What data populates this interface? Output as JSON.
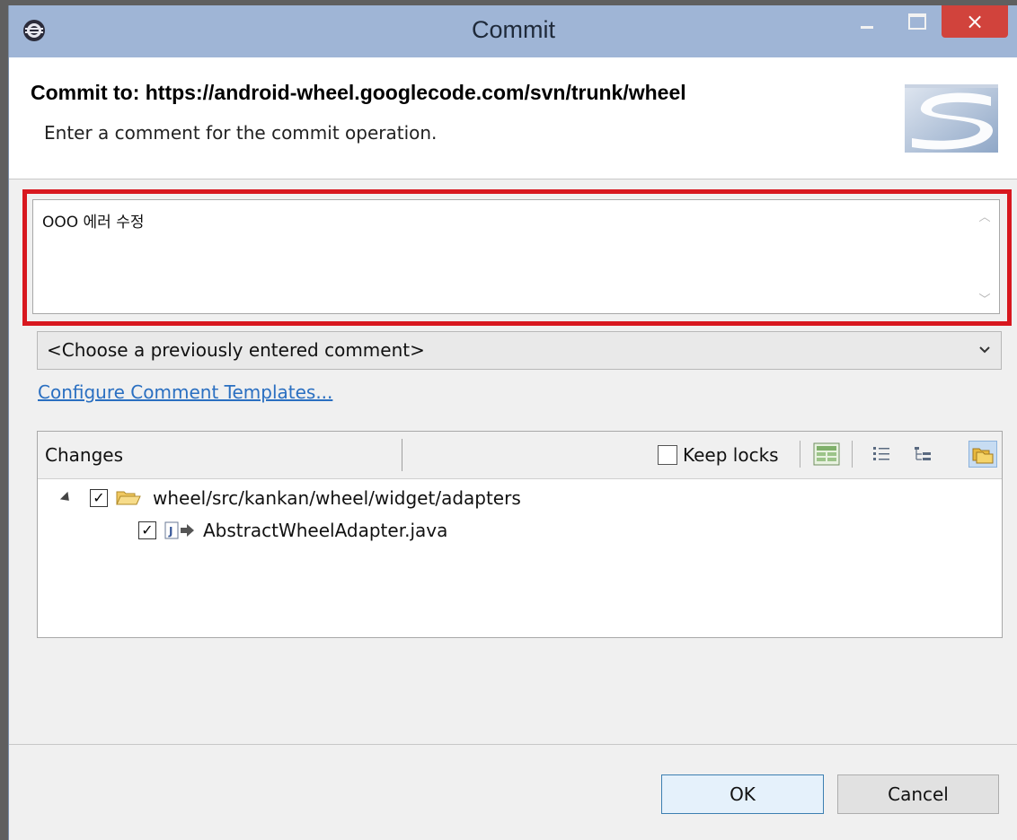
{
  "window": {
    "title": "Commit",
    "minimize_label": "–",
    "close_label": "×"
  },
  "header": {
    "title": "Commit to: https://android-wheel.googlecode.com/svn/trunk/wheel",
    "description": "Enter a comment for the commit operation."
  },
  "comment": {
    "value": "OOO  에러 수정"
  },
  "previous_comments": {
    "selected": "<Choose a previously entered comment>"
  },
  "configure_link": "Configure Comment Templates...",
  "changes": {
    "column_label": "Changes",
    "keep_locks_label": "Keep locks",
    "keep_locks_checked": false,
    "toolbar_icons": [
      "layout-icon",
      "flat-list-icon",
      "tree-icon",
      "compressed-folders-icon"
    ],
    "tree": [
      {
        "label": "wheel/src/kankan/wheel/widget/adapters",
        "checked": true,
        "type": "folder",
        "expanded": true
      },
      {
        "label": "AbstractWheelAdapter.java",
        "checked": true,
        "type": "java-file"
      }
    ]
  },
  "buttons": {
    "ok": "OK",
    "cancel": "Cancel"
  },
  "colors": {
    "titlebar": "#9fb5d6",
    "close": "#d1433c",
    "highlight": "#d8181f",
    "link": "#2a6fc1"
  }
}
